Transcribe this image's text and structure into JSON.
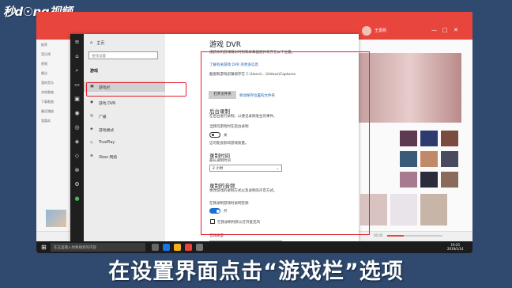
{
  "logo": "秒d☉ng视频",
  "caption": "在设置界面点击“游戏栏”选项",
  "background_app": {
    "username": "王嘉熙",
    "left_items": [
      "推荐",
      "音乐馆",
      "视频",
      "雷达",
      "我的音乐",
      "本地歌曲",
      "下载歌曲",
      "最近播放",
      "我喜欢"
    ],
    "time": "00:45"
  },
  "settings": {
    "nav": {
      "home": "主页",
      "search_placeholder": "查找设置",
      "section": "游戏",
      "items": [
        "游戏栏",
        "游戏 DVR",
        "广播",
        "游戏模式",
        "TruePlay",
        "Xbox 网络"
      ]
    },
    "pane": {
      "title": "游戏 DVR",
      "desc": "捕获你的游戏精彩时刻和屏幕截图并保存在以下位置。",
      "link_more": "了解有关游戏 DVR 的更多信息",
      "save_path": "截图和游戏剪辑保存在 C:\\Users\\...\\Videos\\Captures",
      "open_folder_btn": "打开文件夹",
      "move_folder_link": "移动保存位置的文件夹",
      "bg_record_title": "后台录制",
      "bg_record_desc": "在后台进行录制，以便记录刚发生的事件。",
      "bg_toggle_label": "当我玩游戏时在后台录制",
      "bg_toggle_state": "关",
      "bg_note": "这可能会影响游戏质量。",
      "record_time_title": "录制时间",
      "record_last_label": "最长录制时间",
      "record_last_value": "2 小时",
      "audio_title": "录制的音频",
      "audio_desc": "更改游戏的录制方式以及录制的声音方式。",
      "audio_toggle_label": "在我录制游戏时录制音频",
      "audio_toggle_state": "开",
      "checkbox_label": "在我录制时默认打开麦克风",
      "audio_quality_label": "音频质量"
    }
  },
  "taskbar": {
    "search_placeholder": "在这里输入你要搜索的内容",
    "clock_time": "19:25",
    "clock_date": "2019/1/14"
  }
}
